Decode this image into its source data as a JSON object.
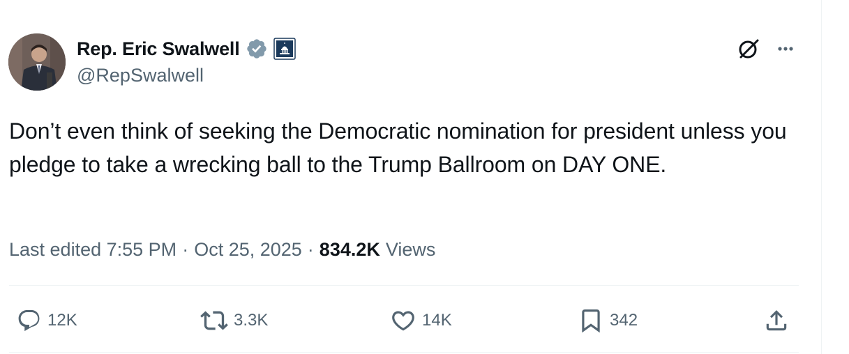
{
  "author": {
    "display_name": "Rep. Eric Swalwell",
    "handle": "@RepSwalwell",
    "avatar_icon": "user-avatar-photo",
    "verified_icon": "verified-badge-icon",
    "affiliation_icon": "us-government-capitol-icon",
    "verified_color": "#829aab",
    "affiliation_color": "#1b3a5c"
  },
  "header_actions": {
    "grok_icon": "grok-slash-circle-icon",
    "more_icon": "more-horizontal-icon"
  },
  "tweet": {
    "text": "Don’t even think of seeking the Democratic nomination for president unless you pledge to take a wrecking ball to the Trump Ballroom on DAY ONE."
  },
  "meta": {
    "edited_label": "Last edited",
    "time": "7:55 PM",
    "separator": "·",
    "date": "Oct 25, 2025",
    "views_count": "834.2K",
    "views_label": "Views"
  },
  "actions": {
    "reply": {
      "icon": "reply-bubble-icon",
      "count": "12K"
    },
    "repost": {
      "icon": "repost-arrows-icon",
      "count": "3.3K"
    },
    "like": {
      "icon": "heart-icon",
      "count": "14K"
    },
    "bookmark": {
      "icon": "bookmark-icon",
      "count": "342"
    },
    "share": {
      "icon": "share-upload-icon"
    }
  },
  "colors": {
    "text_primary": "#0f1419",
    "text_secondary": "#536471",
    "divider": "#eff3f4"
  }
}
